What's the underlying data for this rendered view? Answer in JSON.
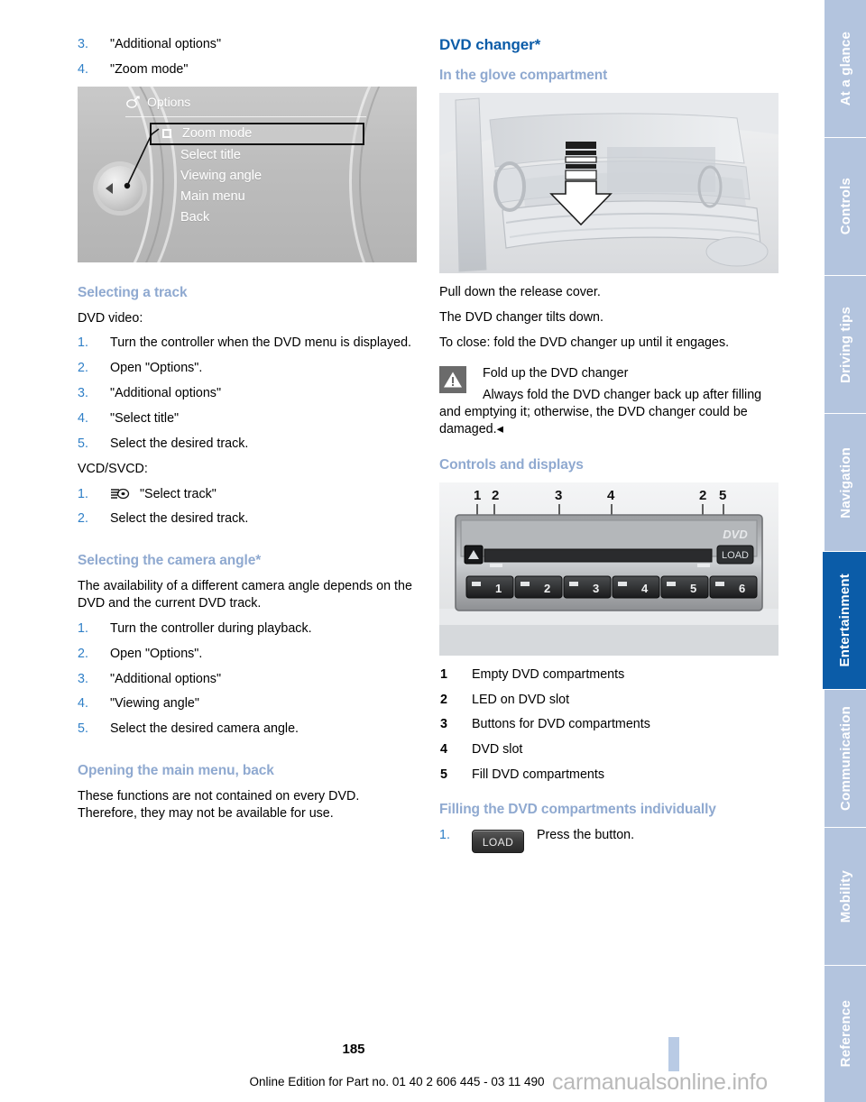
{
  "page": {
    "number": "185",
    "edition": "Online Edition for Part no. 01 40 2 606 445 - 03 11 490",
    "watermark": "carmanualsonline.info"
  },
  "colors": {
    "heading_blue": "#0b5ca8",
    "subheading_blue": "#8fa9d0",
    "step_number_blue": "#2f7fc7",
    "tab_inactive": "#b3c4de",
    "tab_active": "#0b5ca8",
    "page_bar": "#b9cbe5"
  },
  "left_column": {
    "top_steps": [
      {
        "num": "3.",
        "text": "\"Additional options\""
      },
      {
        "num": "4.",
        "text": "\"Zoom mode\""
      }
    ],
    "idrive": {
      "icon": "options-icon",
      "title": "Options",
      "menu": [
        {
          "label": "Zoom mode",
          "selected": true,
          "checkbox": true
        },
        {
          "label": "Select title",
          "selected": false,
          "checkbox": false
        },
        {
          "label": "Viewing angle",
          "selected": false,
          "checkbox": false
        },
        {
          "label": "Main menu",
          "selected": false,
          "checkbox": false
        },
        {
          "label": "Back",
          "selected": false,
          "checkbox": false
        }
      ]
    },
    "selecting_track": {
      "heading": "Selecting a track",
      "intro1": "DVD video:",
      "steps1": [
        {
          "num": "1.",
          "text": "Turn the controller when the DVD menu is displayed."
        },
        {
          "num": "2.",
          "text": "Open \"Options\"."
        },
        {
          "num": "3.",
          "text": "\"Additional options\""
        },
        {
          "num": "4.",
          "text": "\"Select title\""
        },
        {
          "num": "5.",
          "text": "Select the desired track."
        }
      ],
      "intro2": "VCD/SVCD:",
      "steps2": [
        {
          "num": "1.",
          "icon": "select-track-icon",
          "text": "\"Select track\""
        },
        {
          "num": "2.",
          "text": "Select the desired track."
        }
      ]
    },
    "camera_angle": {
      "heading": "Selecting the camera angle*",
      "intro": "The availability of a different camera angle depends on the DVD and the current DVD track.",
      "steps": [
        {
          "num": "1.",
          "text": "Turn the controller during playback."
        },
        {
          "num": "2.",
          "text": "Open \"Options\"."
        },
        {
          "num": "3.",
          "text": "\"Additional options\""
        },
        {
          "num": "4.",
          "text": "\"Viewing angle\""
        },
        {
          "num": "5.",
          "text": "Select the desired camera angle."
        }
      ]
    },
    "main_menu_back": {
      "heading": "Opening the main menu, back",
      "text": "These functions are not contained on every DVD. Therefore, they may not be available for use."
    }
  },
  "right_column": {
    "title": "DVD changer*",
    "glove": {
      "heading": "In the glove compartment",
      "image_alt": "glove-compartment-illustration",
      "p1": "Pull down the release cover.",
      "p2": "The DVD changer tilts down.",
      "p3": "To close: fold the DVD changer up until it engages."
    },
    "warning": {
      "icon": "warning-triangle-icon",
      "title": "Fold up the DVD changer",
      "text": "Always fold the DVD changer back up after filling and emptying it; otherwise, the DVD changer could be damaged.",
      "end_mark": "◂"
    },
    "controls": {
      "heading": "Controls and displays",
      "image_alt": "dvd-changer-front-panel-illustration",
      "callout_numbers": [
        "1",
        "2",
        "3",
        "4",
        "2",
        "5"
      ],
      "panel_buttons": [
        "1",
        "2",
        "3",
        "4",
        "5",
        "6"
      ],
      "panel_load_label": "LOAD",
      "panel_dvd_logo": "DVD",
      "legend": [
        {
          "num": "1",
          "text": "Empty DVD compartments"
        },
        {
          "num": "2",
          "text": "LED on DVD slot"
        },
        {
          "num": "3",
          "text": "Buttons for DVD compartments"
        },
        {
          "num": "4",
          "text": "DVD slot"
        },
        {
          "num": "5",
          "text": "Fill DVD compartments"
        }
      ]
    },
    "filling": {
      "heading": "Filling the DVD compartments individually",
      "step": {
        "num": "1.",
        "button_label": "LOAD",
        "text": "Press the button."
      }
    }
  },
  "rail": {
    "tabs": [
      {
        "label": "At a glance",
        "active": false
      },
      {
        "label": "Controls",
        "active": false
      },
      {
        "label": "Driving tips",
        "active": false
      },
      {
        "label": "Navigation",
        "active": false
      },
      {
        "label": "Entertainment",
        "active": true
      },
      {
        "label": "Communication",
        "active": false
      },
      {
        "label": "Mobility",
        "active": false
      },
      {
        "label": "Reference",
        "active": false
      }
    ]
  }
}
